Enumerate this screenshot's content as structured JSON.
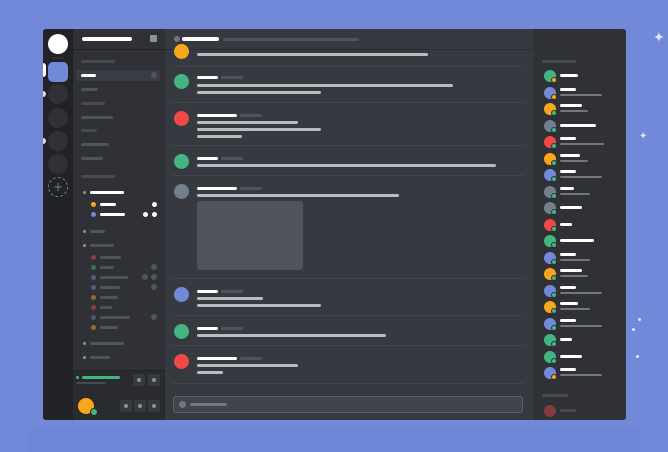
{
  "window": {
    "title": "",
    "accent_color": "#7289da",
    "status_colors": {
      "online": "#43b581",
      "idle": "#faa61a",
      "dnd": "#f04747",
      "offline": "#747f8d"
    }
  },
  "server_rail": {
    "home_icon": "home-icon",
    "server_count": 6,
    "add_server_glyph": "+",
    "add_server_icon": "plus-icon"
  },
  "channel_sidebar": {
    "header_icon": "settings-icon",
    "avatar_colors": [
      "#faa61a",
      "#7289da"
    ],
    "voice_user_dots": [
      "#f04747",
      "#43b581",
      "#747f8d",
      "#7289da",
      "#faa61a",
      "#f04747",
      "#747f8d",
      "#faa61a"
    ]
  },
  "user_panel": {
    "avatar_color": "#faa61a",
    "status": "online",
    "voice_status_color": "#43b581",
    "controls": [
      "mic-icon",
      "headphones-icon",
      "settings-icon"
    ]
  },
  "chat": {
    "header_icon": "hash-icon",
    "input_icon": "plus-icon",
    "messages": [
      {
        "avatar_color": "#faa61a"
      },
      {
        "avatar_color": "#43b581"
      },
      {
        "avatar_color": "#f04747"
      },
      {
        "avatar_color": "#43b581"
      },
      {
        "avatar_color": "#747f8d",
        "has_image_attachment": true
      },
      {
        "avatar_color": "#7289da"
      },
      {
        "avatar_color": "#43b581"
      },
      {
        "avatar_color": "#f04747"
      }
    ]
  },
  "members": {
    "online": [
      {
        "avatar_color": "#43b581",
        "status": "idle"
      },
      {
        "avatar_color": "#7289da",
        "status": "idle"
      },
      {
        "avatar_color": "#faa61a",
        "status": "online"
      },
      {
        "avatar_color": "#747f8d",
        "status": "online"
      },
      {
        "avatar_color": "#f04747",
        "status": "online"
      },
      {
        "avatar_color": "#faa61a",
        "status": "online"
      },
      {
        "avatar_color": "#7289da",
        "status": "online"
      },
      {
        "avatar_color": "#747f8d",
        "status": "online"
      },
      {
        "avatar_color": "#747f8d",
        "status": "online"
      },
      {
        "avatar_color": "#f04747",
        "status": "online"
      },
      {
        "avatar_color": "#43b581",
        "status": "online"
      },
      {
        "avatar_color": "#7289da",
        "status": "online"
      },
      {
        "avatar_color": "#faa61a",
        "status": "online"
      },
      {
        "avatar_color": "#7289da",
        "status": "online"
      },
      {
        "avatar_color": "#faa61a",
        "status": "online"
      },
      {
        "avatar_color": "#7289da",
        "status": "online"
      },
      {
        "avatar_color": "#43b581",
        "status": "online"
      },
      {
        "avatar_color": "#43b581",
        "status": "online"
      },
      {
        "avatar_color": "#7289da",
        "status": "idle"
      }
    ],
    "offline": [
      {
        "avatar_color": "#f04747",
        "status": "offline"
      }
    ]
  }
}
